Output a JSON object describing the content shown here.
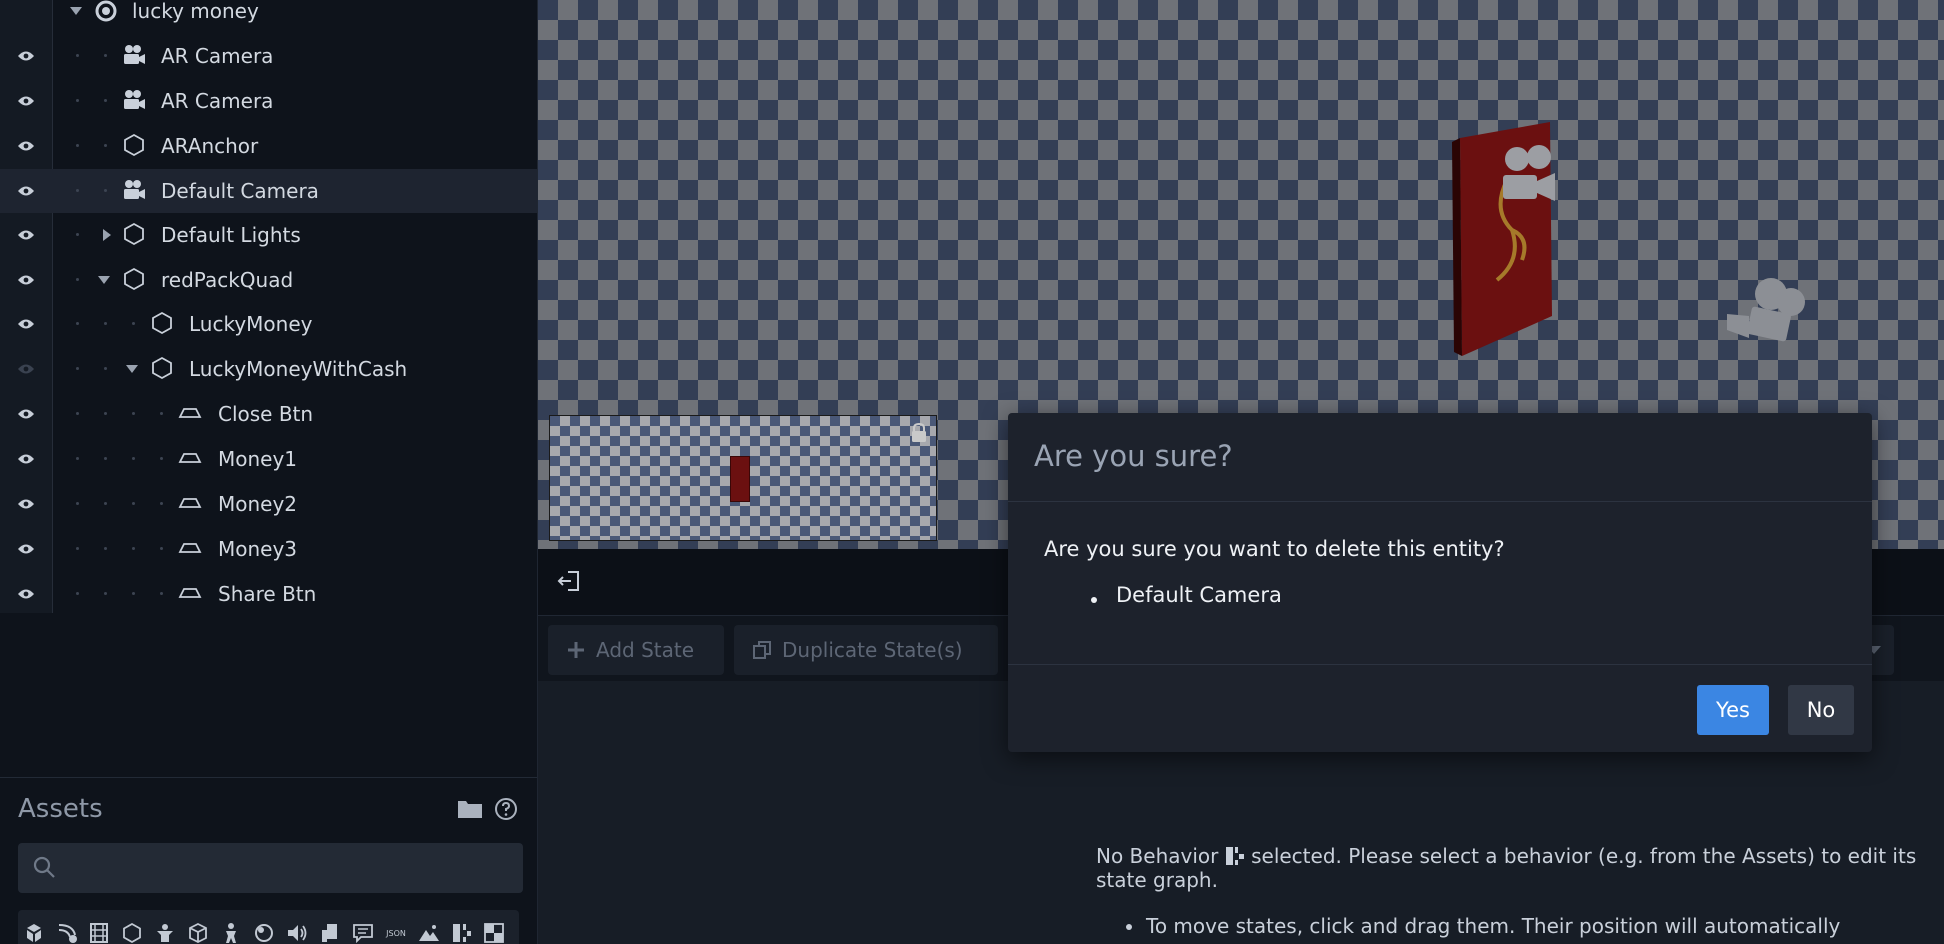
{
  "hierarchy": {
    "root_label": "lucky money",
    "items": [
      {
        "label": "AR Camera",
        "icon": "camera-icon"
      },
      {
        "label": "AR Camera",
        "icon": "camera-icon"
      },
      {
        "label": "ARAnchor",
        "icon": "hexagon-icon"
      },
      {
        "label": "Default Camera",
        "icon": "camera-icon",
        "selected": true
      },
      {
        "label": "Default Lights",
        "icon": "hexagon-icon",
        "collapsed": true
      },
      {
        "label": "redPackQuad",
        "icon": "hexagon-icon",
        "expanded": true
      },
      {
        "label": "LuckyMoney",
        "icon": "hexagon-icon"
      },
      {
        "label": "LuckyMoneyWithCash",
        "icon": "hexagon-icon",
        "expanded": true,
        "hidden": true
      },
      {
        "label": "Close Btn",
        "icon": "plane-icon"
      },
      {
        "label": "Money1",
        "icon": "plane-icon"
      },
      {
        "label": "Money2",
        "icon": "plane-icon"
      },
      {
        "label": "Money3",
        "icon": "plane-icon"
      },
      {
        "label": "Share Btn",
        "icon": "plane-icon"
      }
    ]
  },
  "assets": {
    "title": "Assets",
    "search_placeholder": "",
    "json_badge": "JSON"
  },
  "state_toolbar": {
    "add_state": "Add State",
    "duplicate_state": "Duplicate State(s)"
  },
  "behavior_panel": {
    "message_prefix": "No Behavior",
    "message_suffix": "selected. Please select a behavior (e.g. from the Assets) to edit its state graph.",
    "tip": "To move states, click and drag them. Their position will automatically"
  },
  "modal": {
    "title": "Are you sure?",
    "question": "Are you sure you want to delete this entity?",
    "entity": "Default Camera",
    "yes_label": "Yes",
    "no_label": "No"
  },
  "colors": {
    "accent": "#3b86e3",
    "panel_bg": "#0e131b",
    "modal_bg": "#1d222c",
    "red_pack": "#6b1010"
  }
}
